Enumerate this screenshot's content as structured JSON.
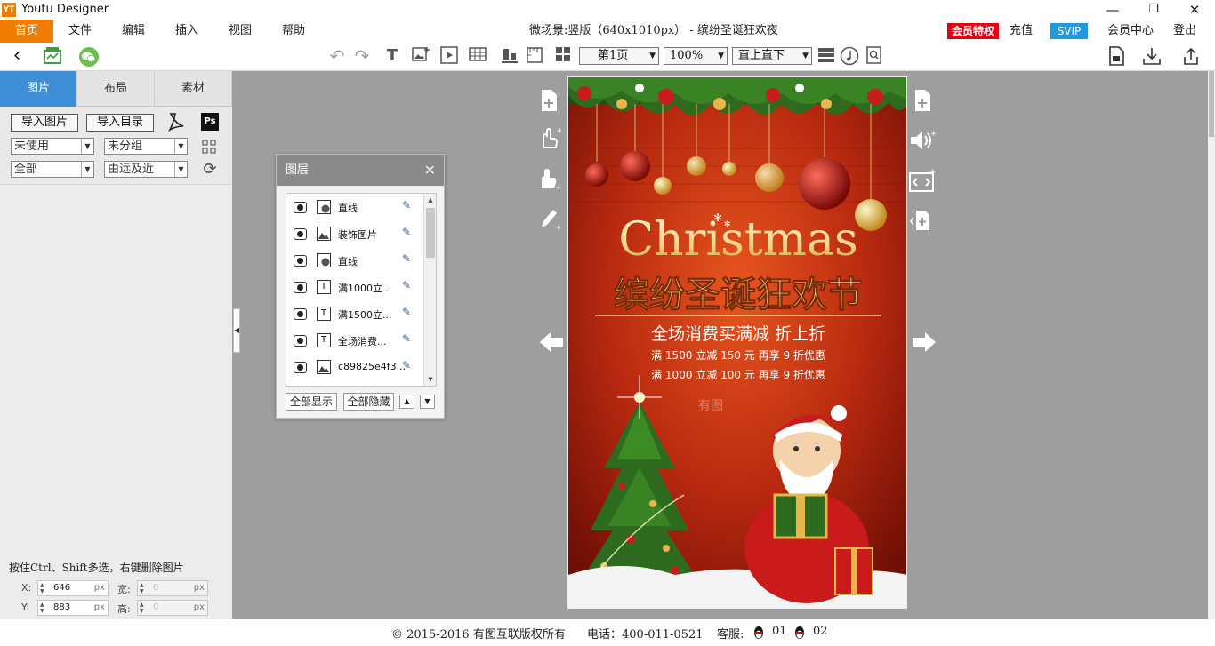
{
  "window": {
    "title": "Youtu Designer",
    "logo_text": "YT"
  },
  "menu": {
    "items": [
      "首页",
      "文件",
      "编辑",
      "插入",
      "视图",
      "帮助"
    ],
    "scene_title": "微场景:竖版（640x1010px） - 缤纷圣诞狂欢夜",
    "vip_label": "会员特权",
    "recharge": "充值",
    "svip": "SVIP",
    "member_center": "会员中心",
    "logout": "登出"
  },
  "toolbar": {
    "page_select": "第1页",
    "zoom_select": "100%",
    "mode_select": "直上直下"
  },
  "left_panel": {
    "tabs": [
      "图片",
      "布局",
      "素材"
    ],
    "active_tab": "图片",
    "import_image": "导入图片",
    "import_dir": "导入目录",
    "filter_usage": "未使用",
    "filter_group": "未分组",
    "filter_all": "全部",
    "sort_order": "由远及近",
    "hint": "按住Ctrl、Shift多选，右键删除图片",
    "x_label": "X:",
    "x_value": "646",
    "y_label": "Y:",
    "y_value": "883",
    "w_label": "宽:",
    "w_value": "0",
    "h_label": "高:",
    "h_value": "0",
    "unit": "px"
  },
  "layers": {
    "title": "图层",
    "items": [
      {
        "type": "shape",
        "name": "直线"
      },
      {
        "type": "image",
        "name": "装饰图片"
      },
      {
        "type": "shape",
        "name": "直线"
      },
      {
        "type": "text",
        "name": "满1000立..."
      },
      {
        "type": "text",
        "name": "满1500立..."
      },
      {
        "type": "text",
        "name": "全场消费..."
      },
      {
        "type": "image",
        "name": "c89825e4f3..."
      }
    ],
    "show_all": "全部显示",
    "hide_all": "全部隐藏"
  },
  "poster": {
    "script_title": "Christmas",
    "headline": "缤纷圣诞狂欢节",
    "subhead": "全场消费买满减 折上折",
    "line1": "满 1500 立减 150 元 再享 9 折优惠",
    "line2": "满 1000 立减 100 元 再享 9 折优惠",
    "watermark": "有图",
    "colors": {
      "bg_red": "#b8290f",
      "dark_red": "#6e0e05",
      "gold": "#f3d48a",
      "green": "#2e6b1e"
    }
  },
  "footer": {
    "copyright": "© 2015-2016 有图互联版权所有",
    "phone": "电话：400-011-0521",
    "service": "客服:",
    "qq1": "01",
    "qq2": "02"
  }
}
